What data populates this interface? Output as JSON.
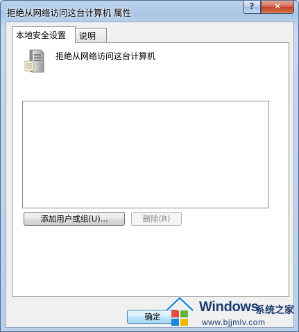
{
  "window": {
    "title": "拒绝从网络访问这台计算机 属性",
    "help_label": "?",
    "close_label": "✕"
  },
  "tabs": [
    {
      "label": "本地安全设置",
      "active": true
    },
    {
      "label": "说明",
      "active": false
    }
  ],
  "policy": {
    "icon": "computer-tower-icon",
    "name": "拒绝从网络访问这台计算机"
  },
  "buttons": {
    "add": "添加用户或组(U)...",
    "remove": "删除(R)",
    "ok": "确定"
  },
  "watermark": {
    "brand": "Windows",
    "site_name": "系统之家",
    "url": "www.bjjmlv.com",
    "colors": {
      "red": "#e84c3d",
      "green": "#62b33d",
      "blue": "#1e88d8",
      "yellow": "#f7b500"
    }
  }
}
